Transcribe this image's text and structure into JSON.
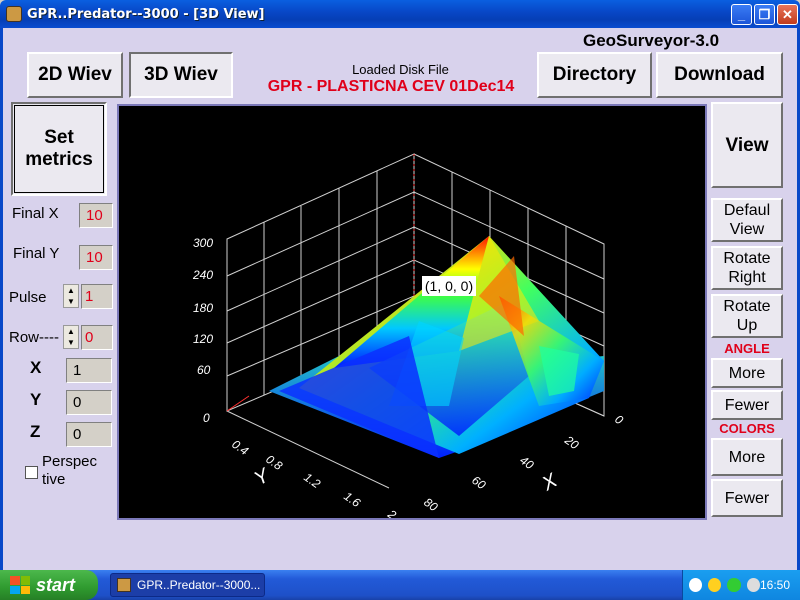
{
  "window": {
    "title": "GPR..Predator--3000 - [3D View]",
    "minimize": "_",
    "restore": "❐",
    "close": "✕"
  },
  "header": {
    "brand": "GeoSurveyor-3.0",
    "loaded_label": "Loaded Disk File",
    "loaded_file": "GPR - PLASTICNA  CEV   01Dec14",
    "tab_2d": "2D Wiev",
    "tab_3d": "3D Wiev",
    "directory": "Directory",
    "download": "Download"
  },
  "left": {
    "set_metrics": "Set metrics",
    "final_x_label": "Final X",
    "final_x": "10",
    "final_y_label": "Final Y",
    "final_y": "10",
    "pulse_label": "Pulse",
    "pulse": "1",
    "row_label": "Row----",
    "row": "0",
    "x_label": "X",
    "x": "1",
    "y_label": "Y",
    "y": "0",
    "z_label": "Z",
    "z": "0",
    "perspective": "Perspec tive"
  },
  "right": {
    "view": "View",
    "default_view": "Defaul View",
    "rotate_right": "Rotate Right",
    "rotate_up": "Rotate Up",
    "angle_label": "ANGLE",
    "angle_more": "More",
    "angle_fewer": "Fewer",
    "colors_label": "COLORS",
    "colors_more": "More",
    "colors_fewer": "Fewer"
  },
  "plot": {
    "cursor_label": "(1, 0, 0)",
    "z_ticks": [
      "60",
      "120",
      "180",
      "240",
      "300"
    ],
    "y_axis_label": "Y",
    "y_ticks": [
      "0",
      "0.4",
      "0.8",
      "1.2",
      "1.6",
      "2"
    ],
    "x_axis_label": "X",
    "x_ticks": [
      "0",
      "20",
      "40",
      "60",
      "80"
    ]
  },
  "taskbar": {
    "start": "start",
    "task": "GPR..Predator--3000...",
    "clock": "16:50"
  },
  "colors": {
    "accent_red": "#e0001a",
    "titlebar_blue": "#0848c8",
    "panel": "#d8d2ec"
  }
}
